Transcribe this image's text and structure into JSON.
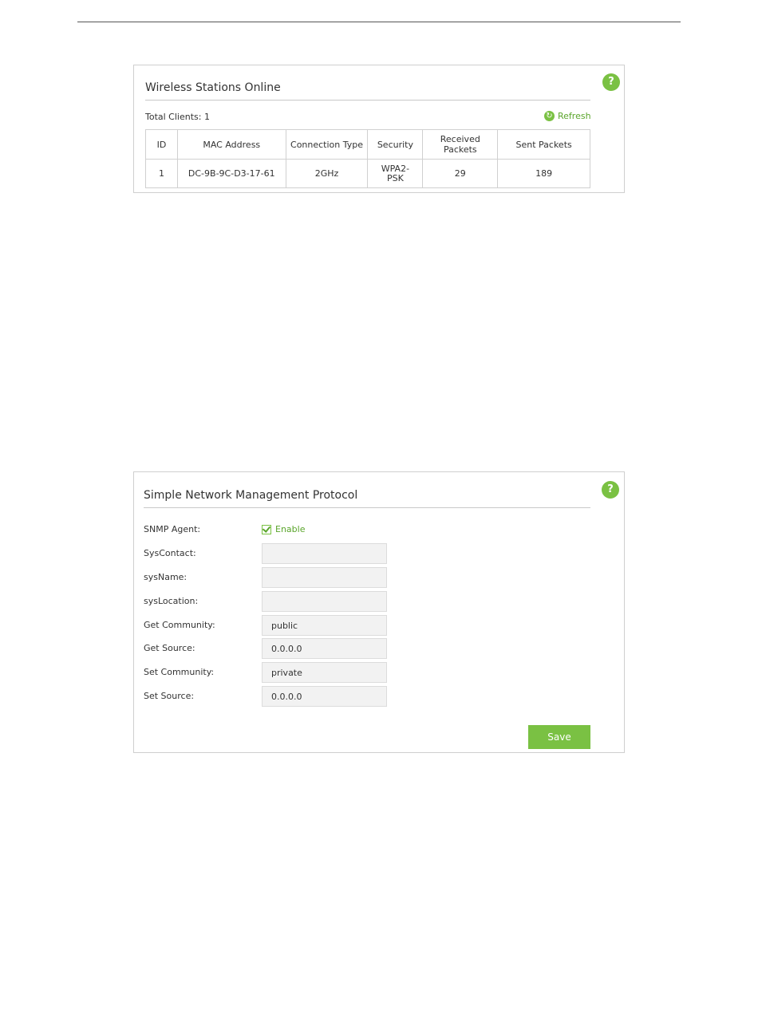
{
  "wireless": {
    "title": "Wireless Stations Online",
    "help_symbol": "?",
    "total_clients": "Total Clients: 1",
    "refresh_label": "Refresh",
    "columns": [
      "ID",
      "MAC Address",
      "Connection Type",
      "Security",
      "Received Packets",
      "Sent Packets"
    ],
    "rows": [
      [
        "1",
        "DC-9B-9C-D3-17-61",
        "2GHz",
        "WPA2-\nPSK",
        "29",
        "189"
      ]
    ]
  },
  "snmp": {
    "title": "Simple Network Management Protocol",
    "help_symbol": "?",
    "agent_label": "SNMP Agent:",
    "agent_enable_label": "Enable",
    "fields": {
      "syscontact": {
        "label": "SysContact:",
        "value": ""
      },
      "sysname": {
        "label": "sysName:",
        "value": ""
      },
      "syslocation": {
        "label": "sysLocation:",
        "value": ""
      },
      "get_community": {
        "label": "Get Community:",
        "value": "public"
      },
      "get_source": {
        "label": "Get Source:",
        "value": "0.0.0.0"
      },
      "set_community": {
        "label": "Set Community:",
        "value": "private"
      },
      "set_source": {
        "label": "Set Source:",
        "value": "0.0.0.0"
      }
    },
    "save_label": "Save"
  },
  "colors": {
    "accent": "#7ac143",
    "accent_text": "#5aa52b",
    "input_bg": "#f2f2f2",
    "border": "#cfcfcf"
  },
  "icons": {
    "help": "help-icon",
    "refresh": "refresh-icon",
    "checkbox": "checkbox-checked-icon"
  }
}
